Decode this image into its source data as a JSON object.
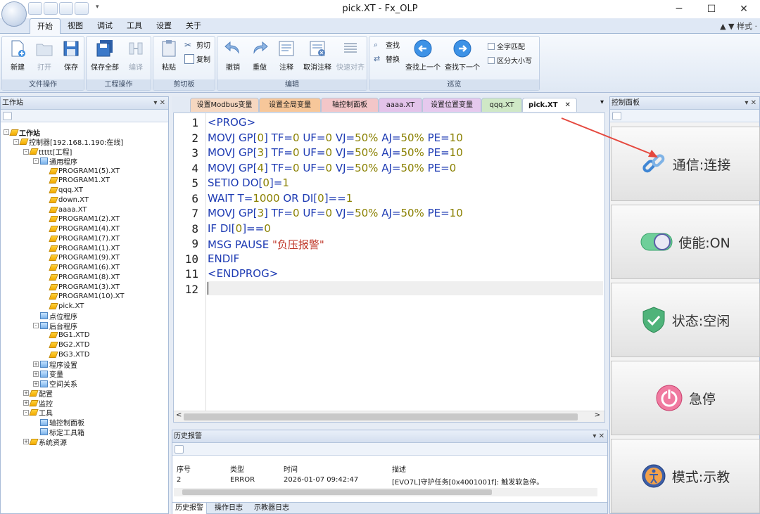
{
  "window": {
    "title": "pick.XT - Fx_OLP",
    "minimize": "─",
    "maximize": "☐",
    "close": "✕"
  },
  "ribbon": {
    "tabs": [
      "开始",
      "视图",
      "调试",
      "工具",
      "设置",
      "关于"
    ],
    "active_tab": "开始",
    "style_label": "▲ ▼  样式 ·",
    "groups": {
      "file": {
        "caption": "文件操作",
        "new": "新建",
        "open": "打开",
        "save": "保存"
      },
      "project": {
        "caption": "工程操作",
        "save_all": "保存全部",
        "compile": "编译"
      },
      "clipboard": {
        "caption": "剪切板",
        "paste": "粘贴",
        "cut": "剪切",
        "copy": "复制"
      },
      "edit": {
        "caption": "编辑",
        "undo": "撤销",
        "redo": "重做",
        "comment": "注释",
        "uncomment": "取消注释",
        "quick_align": "快速对齐"
      },
      "browse": {
        "caption": "巡览",
        "find": "查找",
        "replace": "替换",
        "find_prev": "查找上一个",
        "find_next": "查找下一个",
        "whole_word": "全字匹配",
        "match_case": "区分大小写"
      }
    }
  },
  "workstation": {
    "title": "工作站",
    "tree": {
      "root": "工作站",
      "controller": "控制器[192.168.1.190:在线]",
      "project": "ttttt[工程]",
      "general": "通用程序",
      "programs": [
        "PROGRAM1(5).XT",
        "PROGRAM1.XT",
        "qqq.XT",
        "down.XT",
        "aaaa.XT",
        "PROGRAM1(2).XT",
        "PROGRAM1(4).XT",
        "PROGRAM1(7).XT",
        "PROGRAM1(1).XT",
        "PROGRAM1(9).XT",
        "PROGRAM1(6).XT",
        "PROGRAM1(8).XT",
        "PROGRAM1(3).XT",
        "PROGRAM1(10).XT",
        "pick.XT"
      ],
      "points": "点位程序",
      "background": "后台程序",
      "bg_files": [
        "BG1.XTD",
        "BG2.XTD",
        "BG3.XTD"
      ],
      "prog_settings": "程序设置",
      "variables": "变量",
      "space": "空间关系",
      "config": "配置",
      "monitor": "监控",
      "tools": "工具",
      "axis_panel": "轴控制面板",
      "calib": "标定工具箱",
      "sysres": "系统资源"
    }
  },
  "doc_tabs": [
    {
      "label": "设置Modbus变量",
      "color": "#f6d7c0"
    },
    {
      "label": "设置全局变量",
      "color": "#f7c79a"
    },
    {
      "label": "轴控制面板",
      "color": "#f3c6c8"
    },
    {
      "label": "aaaa.XT",
      "color": "#e3c3ea"
    },
    {
      "label": "设置位置变量",
      "color": "#e6c9ee"
    },
    {
      "label": "qqq.XT",
      "color": "#cfe8c6"
    },
    {
      "label": "pick.XT",
      "color": "#f4d2e4"
    }
  ],
  "doc_tab_close": "✕",
  "editor": {
    "line_numbers": [
      "1",
      "2",
      "3",
      "4",
      "5",
      "6",
      "7",
      "8",
      "9",
      "10",
      "11",
      "12"
    ],
    "scroll_left": "<",
    "scroll_right": ">"
  },
  "history": {
    "title": "历史报警",
    "headers": {
      "no": "序号",
      "type": "类型",
      "time": "时间",
      "desc": "描述"
    },
    "rows": [
      {
        "no": "2",
        "type": "ERROR",
        "time": "2026-01-07 09:42:47",
        "desc": "[EVO7L]守护任务[0x4001001f]: 触发软急停。"
      }
    ],
    "tabs": [
      "历史报警",
      "操作日志",
      "示教器日志"
    ]
  },
  "control_panel": {
    "title": "控制面板",
    "buttons": [
      {
        "label": "通信:连接",
        "icon": "link-icon"
      },
      {
        "label": "使能:ON",
        "icon": "toggle-icon"
      },
      {
        "label": "状态:空闲",
        "icon": "shield-check-icon"
      },
      {
        "label": "急停",
        "icon": "power-icon"
      },
      {
        "label": "模式:示教",
        "icon": "person-icon"
      }
    ]
  },
  "pane_controls": "▾ ✕"
}
